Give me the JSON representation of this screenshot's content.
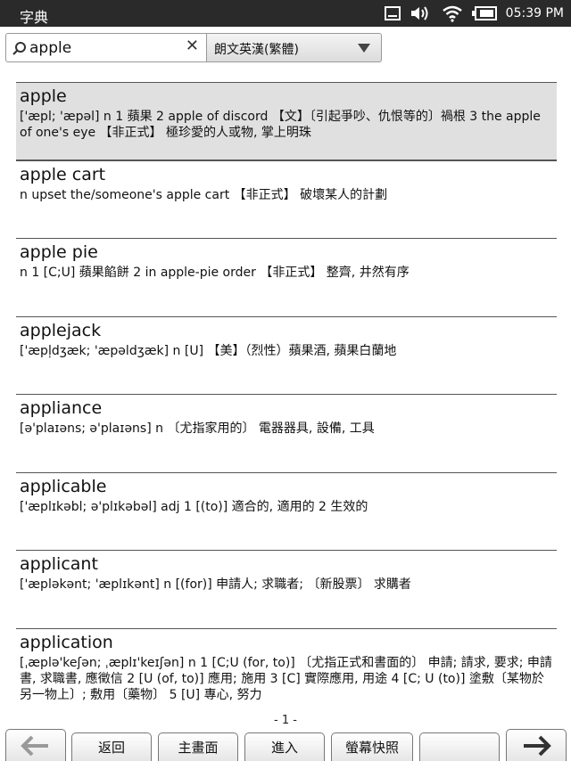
{
  "status_bar": {
    "app_title": "字典",
    "time": "05:39 PM"
  },
  "search": {
    "query": "apple",
    "dictionary": "朗文英漢(繁體)"
  },
  "entries": [
    {
      "word": "apple",
      "definition": "['æpl; 'æpəl] n 1 蘋果 2 apple of discord 【文】〔引起爭吵、仇恨等的〕禍根 3 the apple of one's eye 【非正式】 極珍愛的人或物, 掌上明珠"
    },
    {
      "word": "apple cart",
      "definition": "n upset the/someone's apple cart 【非正式】 破壞某人的計劃"
    },
    {
      "word": "apple pie",
      "definition": "n 1 [C;U] 蘋果餡餅 2 in apple-pie order 【非正式】 整齊, 井然有序"
    },
    {
      "word": "applejack",
      "definition": "['æpl̩dʒæk; 'æpəldʒæk] n [U] 【美】（烈性）蘋果酒, 蘋果白蘭地"
    },
    {
      "word": "appliance",
      "definition": "[ə'plaɪəns; ə'plaɪəns] n 〔尤指家用的〕 電器器具, 設備, 工具"
    },
    {
      "word": "applicable",
      "definition": "['æplɪkəbl; ə'plɪkəbəl] adj 1 [(to)] 適合的, 適用的 2 生效的"
    },
    {
      "word": "applicant",
      "definition": "['æpləkənt; 'æplɪkənt] n [(for)] 申請人; 求職者; 〔新股票〕 求購者"
    },
    {
      "word": "application",
      "definition": "[ˌæplə'keʃən; ˌæplɪ'keɪʃən] n 1 [C;U (for, to)] 〔尤指正式和書面的〕 申請; 請求, 要求; 申請書, 求職書, 應徵信 2 [U (of, to)] 應用; 施用 3 [C] 實際應用, 用途 4 [C; U (to)] 塗敷〔某物於另一物上〕; 敷用〔藥物〕 5 [U] 專心, 努力"
    }
  ],
  "page_number": "- 1 -",
  "bottom_nav": {
    "back_label": "返回",
    "home_label": "主畫面",
    "enter_label": "進入",
    "screenshot_label": "螢幕快照",
    "blank_label": ""
  }
}
